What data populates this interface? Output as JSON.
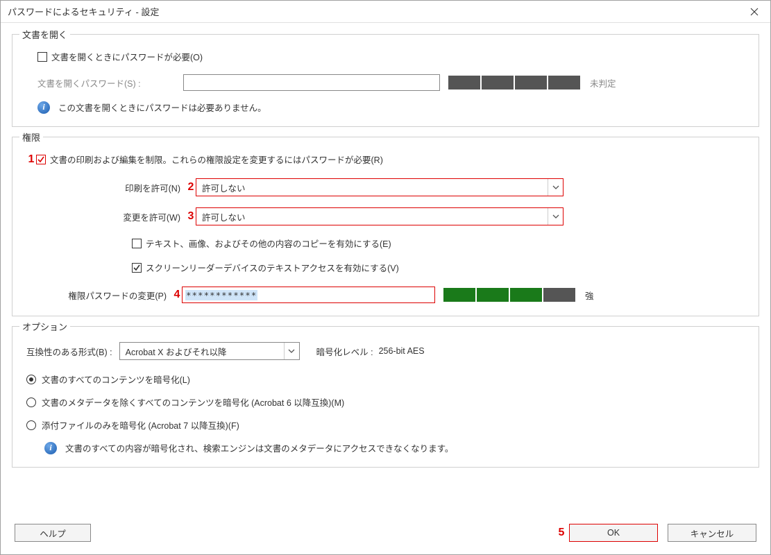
{
  "window": {
    "title": "パスワードによるセキュリティ - 設定"
  },
  "group1": {
    "legend": "文書を開く",
    "require_open_pw_label": "文書を開くときにパスワードが必要(O)",
    "open_pw_label": "文書を開くパスワード(S) :",
    "open_pw_value": "",
    "open_strength_label": "未判定",
    "info": "この文書を開くときにパスワードは必要ありません。"
  },
  "group2": {
    "legend": "権限",
    "restrict_label": "文書の印刷および編集を制限。これらの権限設定を変更するにはパスワードが必要(R)",
    "print_label": "印刷を許可(N)",
    "print_value": "許可しない",
    "change_label": "変更を許可(W)",
    "change_value": "許可しない",
    "copy_label": "テキスト、画像、およびその他の内容のコピーを有効にする(E)",
    "reader_label": "スクリーンリーダーデバイスのテキストアクセスを有効にする(V)",
    "perm_pw_label": "権限パスワードの変更(P)",
    "perm_pw_value": "************",
    "perm_strength_label": "強"
  },
  "group3": {
    "legend": "オプション",
    "compat_label": "互換性のある形式(B) :",
    "compat_value": "Acrobat X およびそれ以降",
    "enc_level_label": "暗号化レベル :",
    "enc_level_value": "256-bit AES",
    "radio_all": "文書のすべてのコンテンツを暗号化(L)",
    "radio_meta": "文書のメタデータを除くすべてのコンテンツを暗号化 (Acrobat 6 以降互換)(M)",
    "radio_attach": "添付ファイルのみを暗号化 (Acrobat 7 以降互換)(F)",
    "info": "文書のすべての内容が暗号化され、検索エンジンは文書のメタデータにアクセスできなくなります。"
  },
  "markers": {
    "m1": "1",
    "m2": "2",
    "m3": "3",
    "m4": "4",
    "m5": "5"
  },
  "buttons": {
    "help": "ヘルプ",
    "ok": "OK",
    "cancel": "キャンセル"
  }
}
